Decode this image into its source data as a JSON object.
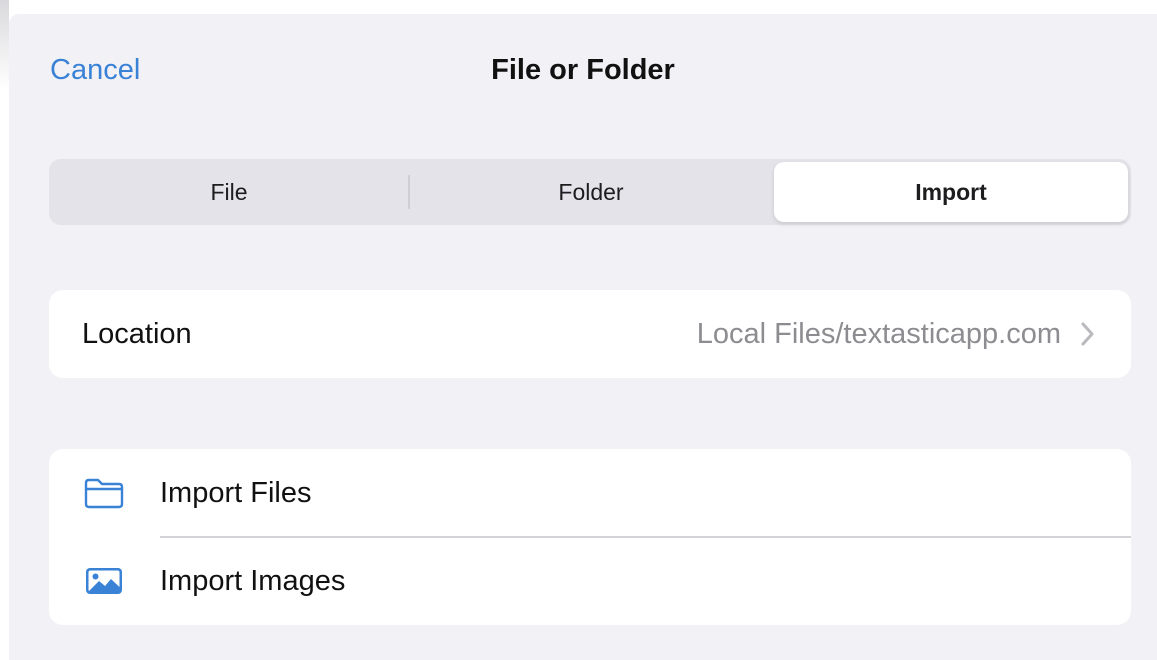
{
  "navbar": {
    "cancel_label": "Cancel",
    "title": "File or Folder"
  },
  "segments": {
    "items": [
      "File",
      "Folder",
      "Import"
    ],
    "selected": "Import"
  },
  "location": {
    "label": "Location",
    "value": "Local Files/textasticapp.com",
    "chevron_icon": "chevron-right-icon"
  },
  "imports": [
    {
      "label": "Import Files",
      "icon": "folder-icon"
    },
    {
      "label": "Import Images",
      "icon": "photo-icon"
    }
  ],
  "colors": {
    "accent": "#3a82d6",
    "background": "#f2f1f6",
    "secondary_text": "#8c8c91"
  }
}
